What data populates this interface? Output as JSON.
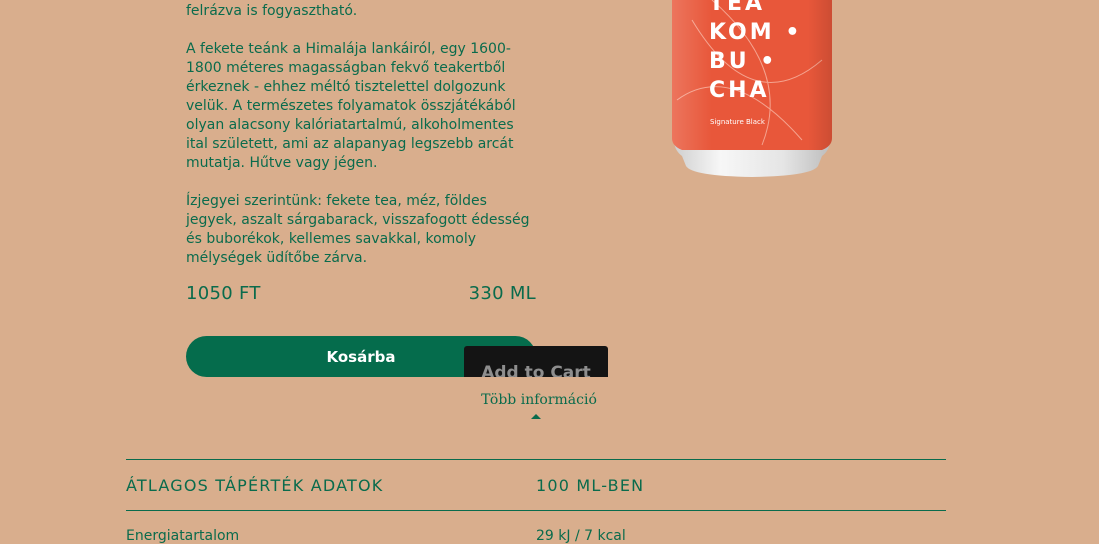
{
  "product": {
    "description": [
      "felrázva is fogyasztható.",
      "A fekete teánk a Himalája lankáiról, egy 1600-1800 méteres magasságban fekvő teakertből érkeznek - ehhez méltó tisztelettel dolgozunk velük. A természetes folyamatok összjátékából olyan alacsony kalóriatartalmú, alkoholmentes ital született, ami az alapanyag legszebb arcát mutatja. Hűtve vagy jégen.",
      "Ízjegyei szerintünk: fekete tea, méz, földes jegyek, aszalt sárgabarack, visszafogott édesség és buborékok, kellemes savakkal, komoly mélységek üdítőbe zárva."
    ],
    "price": "1050 FT",
    "volume": "330 ML",
    "cart_button": "Kosárba",
    "tooltip": "Add to Cart",
    "more_info": "Több információ",
    "can": {
      "lines": [
        "TEA",
        "KOM •",
        "BU •",
        "CHA"
      ],
      "label": "Signature Black",
      "color": "#e8573a"
    }
  },
  "nutrition": {
    "header_left": "ÁTLAGOS TÁPÉRTÉK ADATOK",
    "header_right": "100 ML-BEN",
    "rows": [
      {
        "name": "Energiatartalom",
        "value": "29 kJ / 7 kcal"
      }
    ]
  },
  "colors": {
    "background": "#d9ae8d",
    "accent": "#056c4c",
    "text": "#0a6b4c"
  }
}
